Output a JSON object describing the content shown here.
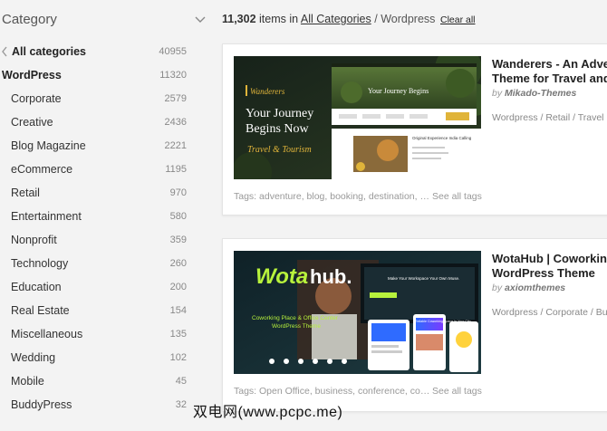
{
  "sidebar": {
    "header": "Category",
    "categories": [
      {
        "label": "All categories",
        "count": "40955"
      },
      {
        "label": "WordPress",
        "count": "11320"
      },
      {
        "label": "Corporate",
        "count": "2579"
      },
      {
        "label": "Creative",
        "count": "2436"
      },
      {
        "label": "Blog Magazine",
        "count": "2221"
      },
      {
        "label": "eCommerce",
        "count": "1195"
      },
      {
        "label": "Retail",
        "count": "970"
      },
      {
        "label": "Entertainment",
        "count": "580"
      },
      {
        "label": "Nonprofit",
        "count": "359"
      },
      {
        "label": "Technology",
        "count": "260"
      },
      {
        "label": "Education",
        "count": "200"
      },
      {
        "label": "Real Estate",
        "count": "154"
      },
      {
        "label": "Miscellaneous",
        "count": "135"
      },
      {
        "label": "Wedding",
        "count": "102"
      },
      {
        "label": "Mobile",
        "count": "45"
      },
      {
        "label": "BuddyPress",
        "count": "32"
      }
    ]
  },
  "results": {
    "count": "11,302",
    "items_in": "items in",
    "all_categories": "All Categories",
    "separator": "/",
    "current": "Wordpress",
    "clear_all": "Clear all"
  },
  "items": [
    {
      "title": "Wanderers - An Adve Theme for Travel and",
      "by_prefix": "by",
      "author": "Mikado-Themes",
      "categories": "Wordpress / Retail / Travel",
      "tags": "Tags: adventure, blog, booking, destination, ex...",
      "see_all": "See all tags",
      "thumb": {
        "logo": "Wanderers",
        "headline_line1": "Your Journey",
        "headline_line2": "Begins Now",
        "script": "Travel & Tourism",
        "banner": "Your Journey Begins",
        "panel_title": "Original Experience India Calling"
      }
    },
    {
      "title": "WotaHub | Coworkin WordPress Theme",
      "by_prefix": "by",
      "author": "axiomthemes",
      "categories": "Wordpress / Corporate / Busi",
      "tags": "Tags: Open Office, business, conference, corp...",
      "see_all": "See all tags",
      "thumb": {
        "logo_part1": "Wota",
        "logo_part2": "hub.",
        "subtitle_line1": "Coworking Place & Office Center",
        "subtitle_line2": "WordPress Theme",
        "screen_text": "Make Your Workspace Your Own Muse.",
        "panel_text": "Reliable Coworking Space In Your City"
      }
    }
  ],
  "watermark": "双电网(www.pcpc.me)",
  "colors": {
    "background": "#f3f3f3",
    "card": "#ffffff",
    "wanderers_bg": "#1f2b1c",
    "wanderers_gold": "#e0b43a",
    "wotahub_bg": "#142a30",
    "wotahub_green": "#b8f23c"
  }
}
